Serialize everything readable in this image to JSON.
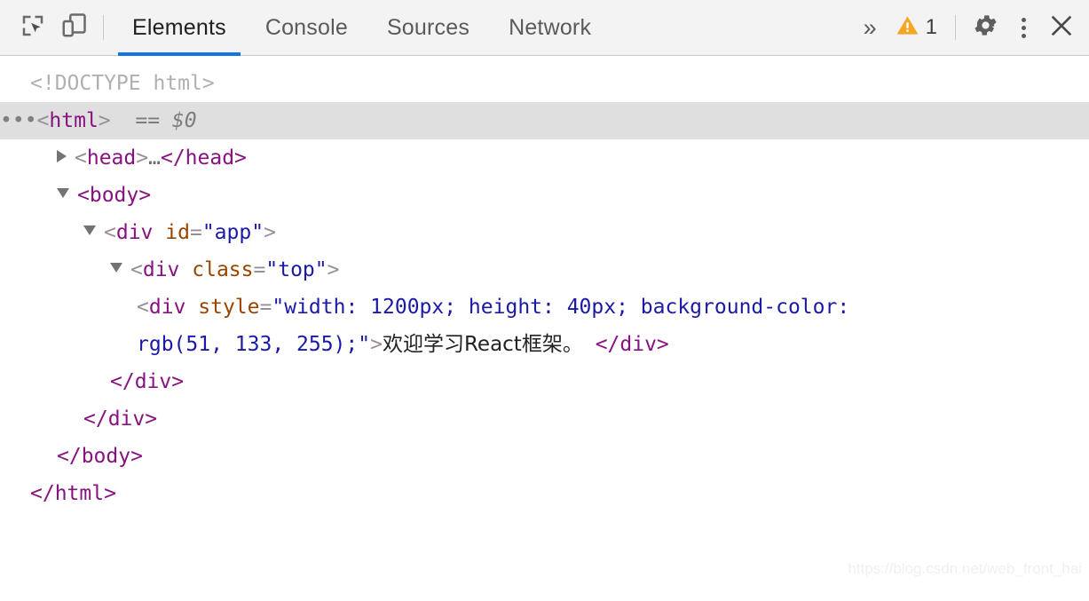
{
  "toolbar": {
    "inspect_icon": "inspect-element-icon",
    "device_icon": "device-toolbar-icon",
    "tabs": [
      {
        "label": "Elements",
        "active": true
      },
      {
        "label": "Console",
        "active": false
      },
      {
        "label": "Sources",
        "active": false
      },
      {
        "label": "Network",
        "active": false
      }
    ],
    "overflow_label": "»",
    "warning_icon": "warning-triangle-icon",
    "warning_count": "1",
    "settings_icon": "gear-icon",
    "more_icon": "kebab-menu-icon",
    "close_icon": "close-icon",
    "accent_color": "#1473e6",
    "warning_color": "#f5a623"
  },
  "dom": {
    "doctype": "<!DOCTYPE html>",
    "selected_marker": "•••",
    "html_open_lt": "<",
    "html_tag": "html",
    "html_gt": ">",
    "selected_suffix": "== $0",
    "head_line": {
      "lt": "<",
      "tag": "head",
      "gt": ">",
      "ellipsis": "…",
      "close": "</head>"
    },
    "body_open": "<body>",
    "div_app": {
      "lt": "<",
      "tag": "div",
      "attr": "id",
      "eq": "=",
      "value": "\"app\"",
      "gt": ">"
    },
    "div_top": {
      "lt": "<",
      "tag": "div",
      "attr": "class",
      "eq": "=",
      "value": "\"top\"",
      "gt": ">"
    },
    "div_styled": {
      "lt": "<",
      "tag": "div",
      "attr": "style",
      "eq": "=",
      "value_line1": "\"width: 1200px; height: 40px; background-color:",
      "value_line2": "rgb(51, 133, 255);\"",
      "gt": ">",
      "text": "欢迎学习React框架。",
      "close": "</div>"
    },
    "close_div_inner": "</div>",
    "close_div_app": "</div>",
    "close_body": "</body>",
    "close_html": "</html>"
  },
  "watermark": {
    "text": "https://blog.csdn.net/web_front_hai"
  }
}
